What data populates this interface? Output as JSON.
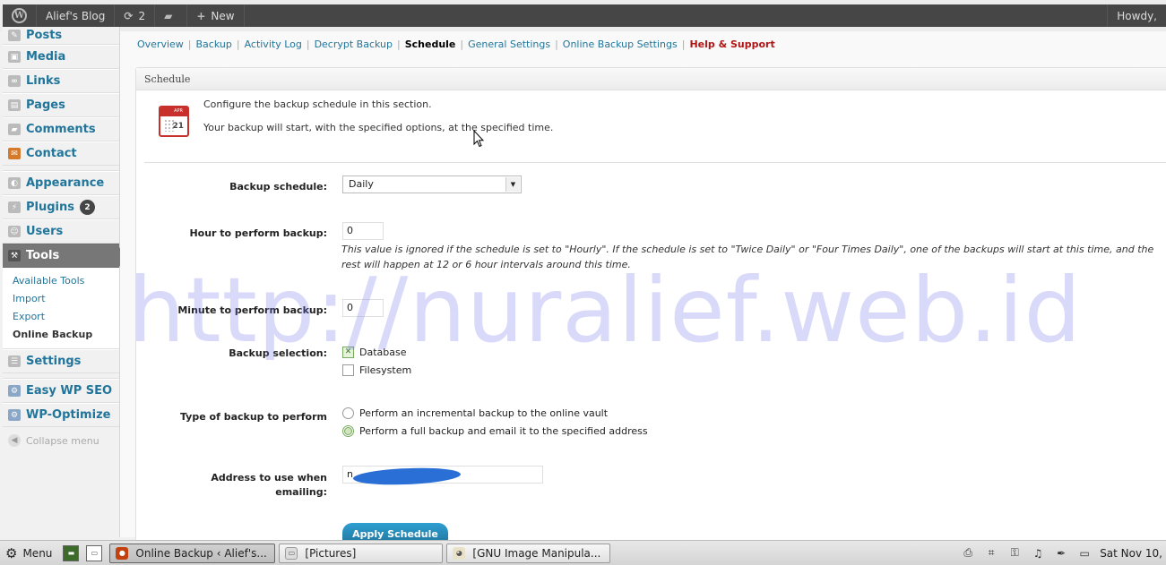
{
  "adminbar": {
    "site_name": "Alief's Blog",
    "updates_count": "2",
    "new_label": "New",
    "howdy": "Howdy,"
  },
  "menu": {
    "items_top": [
      {
        "label": "Posts",
        "icon": "pin-icon"
      },
      {
        "label": "Media",
        "icon": "media-icon"
      },
      {
        "label": "Links",
        "icon": "link-icon"
      },
      {
        "label": "Pages",
        "icon": "page-icon"
      },
      {
        "label": "Comments",
        "icon": "comment-icon"
      },
      {
        "label": "Contact",
        "icon": "contact-icon"
      }
    ],
    "appearance": "Appearance",
    "plugins": "Plugins",
    "plugins_badge": "2",
    "users": "Users",
    "tools": "Tools",
    "tools_sub": [
      "Available Tools",
      "Import",
      "Export",
      "Online Backup"
    ],
    "settings": "Settings",
    "seo": "Easy WP SEO",
    "optimize": "WP-Optimize",
    "collapse": "Collapse menu"
  },
  "subnav": {
    "overview": "Overview",
    "backup": "Backup",
    "activity": "Activity Log",
    "decrypt": "Decrypt Backup",
    "schedule": "Schedule",
    "general": "General Settings",
    "online": "Online Backup Settings",
    "help": "Help & Support"
  },
  "panel": {
    "title": "Schedule",
    "cal_month": "APR",
    "cal_day": "21",
    "intro1": "Configure the backup schedule in this section.",
    "intro2": "Your backup will start, with the specified options, at the specified time."
  },
  "form": {
    "schedule_label": "Backup schedule:",
    "schedule_value": "Daily",
    "hour_label": "Hour to perform backup:",
    "hour_value": "0",
    "hour_note": "This value is ignored if the schedule is set to \"Hourly\". If the schedule is set to \"Twice Daily\" or \"Four Times Daily\", one of the backups will start at this time, and the rest will happen at 12 or 6 hour intervals around this time.",
    "minute_label": "Minute to perform backup:",
    "minute_value": "0",
    "selection_label": "Backup selection:",
    "opt_database": "Database",
    "opt_filesystem": "Filesystem",
    "type_label": "Type of backup to perform",
    "opt_incremental": "Perform an incremental backup to the online vault",
    "opt_full": "Perform a full backup and email it to the specified address",
    "email_label_1": "Address to use when",
    "email_label_2": "emailing:",
    "email_value": "n",
    "apply": "Apply Schedule"
  },
  "watermark": "http://nuralief.web.id",
  "taskbar": {
    "menu": "Menu",
    "task1": "Online Backup ‹ Alief's...",
    "task2": "[Pictures]",
    "task3": "[GNU Image Manipula...",
    "clock": "Sat Nov 10,"
  }
}
